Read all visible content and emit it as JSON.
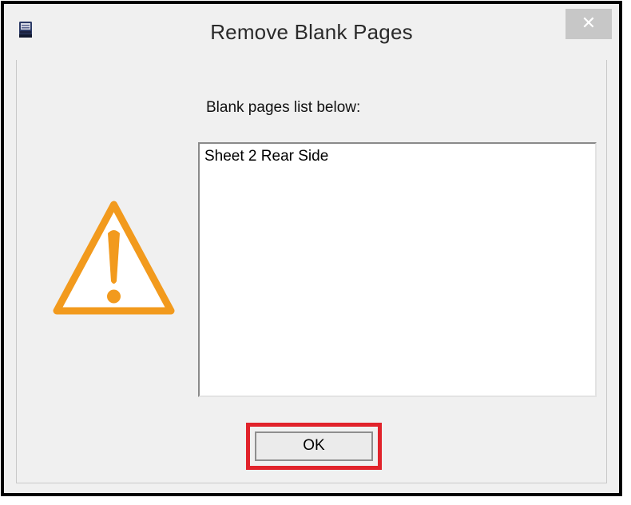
{
  "window": {
    "title": "Remove Blank Pages",
    "close_glyph": "✕",
    "app_icon": "printer-app-icon"
  },
  "dialog": {
    "icon": "warning-icon",
    "label": "Blank pages list below:",
    "list_items": [
      "Sheet 2 Rear Side"
    ],
    "ok_label": "OK"
  },
  "colors": {
    "warning_orange": "#f29a1d",
    "highlight_red": "#e1232b",
    "dialog_bg": "#f0f0f0"
  }
}
